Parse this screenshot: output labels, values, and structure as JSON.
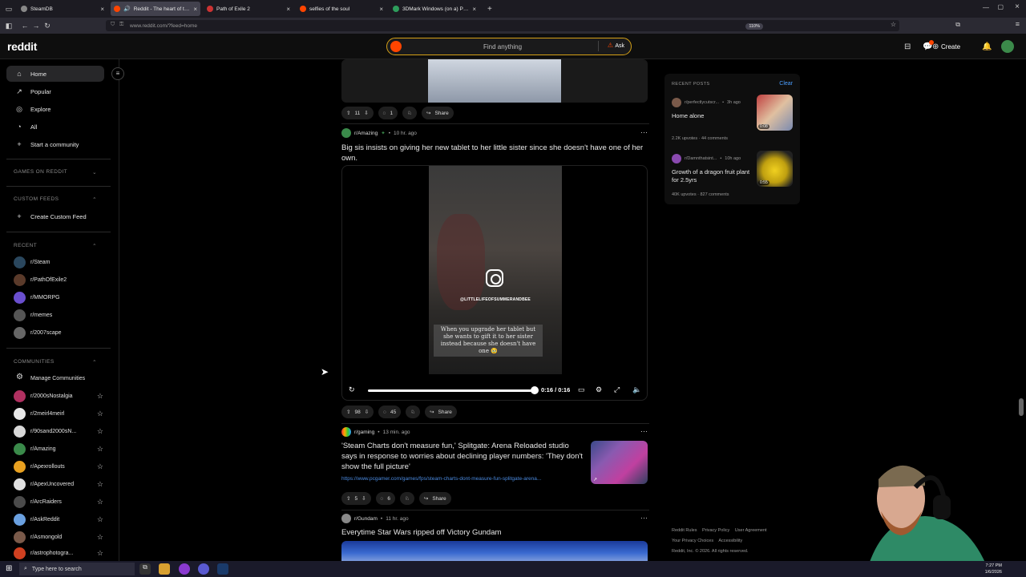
{
  "browser": {
    "tabs": [
      {
        "title": "SteamDB",
        "color": "#888888"
      },
      {
        "title": "Reddit - The heart of the internet",
        "color": "#ff4500"
      },
      {
        "title": "Path of Exile 2",
        "color": "#cc3333"
      },
      {
        "title": "selfies of the soul",
        "color": "#ff4500"
      },
      {
        "title": "3DMark Windows (on a) Phone",
        "color": "#2e9d5c"
      }
    ],
    "new_tab": "+",
    "url": "www.reddit.com/?feed=home",
    "zoom": "110%"
  },
  "header": {
    "logo": "reddit",
    "search_placeholder": "Find anything",
    "ask_label": "Ask",
    "create_label": "Create"
  },
  "sidebar": {
    "nav": [
      {
        "label": "Home",
        "icon": "home-icon"
      },
      {
        "label": "Popular",
        "icon": "popular-icon"
      },
      {
        "label": "Explore",
        "icon": "explore-icon"
      },
      {
        "label": "All",
        "icon": "all-icon"
      },
      {
        "label": "Start a community",
        "icon": "plus-icon"
      }
    ],
    "games_heading": "GAMES ON REDDIT",
    "custom_feeds_heading": "CUSTOM FEEDS",
    "create_custom_feed": "Create Custom Feed",
    "recent_heading": "RECENT",
    "recent": [
      {
        "name": "r/Steam",
        "color": "#2a475e"
      },
      {
        "name": "r/PathOfExile2",
        "color": "#5a3a2a"
      },
      {
        "name": "r/MMORPG",
        "color": "#6a4fcf"
      },
      {
        "name": "r/memes",
        "color": "#555555"
      },
      {
        "name": "r/2007scape",
        "color": "#666666"
      }
    ],
    "communities_heading": "COMMUNITIES",
    "manage_communities": "Manage Communities",
    "communities": [
      {
        "name": "r/2000sNostalgia",
        "color": "#b03060"
      },
      {
        "name": "r/2meirl4meirl",
        "color": "#e8e8e8"
      },
      {
        "name": "r/90sand2000sN...",
        "color": "#d8d8d8"
      },
      {
        "name": "r/Amazing",
        "color": "#3a8a4a"
      },
      {
        "name": "r/Apexrollouts",
        "color": "#e8a020"
      },
      {
        "name": "r/ApexUncovered",
        "color": "#e0e0e0"
      },
      {
        "name": "r/ArcRaiders",
        "color": "#4a4a4a"
      },
      {
        "name": "r/AskReddit",
        "color": "#6aa0e0"
      },
      {
        "name": "r/Asmongold",
        "color": "#7a5a4a"
      },
      {
        "name": "r/astrophotogra...",
        "color": "#d04020"
      }
    ]
  },
  "feed": {
    "post0_actions": {
      "votes": "11",
      "comments": "1",
      "share": "Share"
    },
    "post1": {
      "subreddit": "r/Amazing",
      "time": "10 hr. ago",
      "title": "Big sis insists on giving her new tablet to her little sister since she doesn't have one of her own.",
      "ig_handle": "@LITTLELIFEOFSUMMERANDBEE",
      "caption": "When you upgrade her tablet but she wants to gift it to her sister instead because she doesn't have one 🥹",
      "video_time": "0:16 / 0:16",
      "progress": 1.0,
      "votes": "98",
      "comments": "45",
      "share": "Share"
    },
    "post2": {
      "subreddit": "r/gaming",
      "time": "13 min. ago",
      "title": "'Steam Charts don't measure fun,' Splitgate: Arena Reloaded studio says in response to worries about declining player numbers: 'They don't show the full picture'",
      "link": "https://www.pcgamer.com/games/fps/steam-charts-dont-measure-fun-splitgate-arena...",
      "votes": "5",
      "comments": "6",
      "share": "Share"
    },
    "post3": {
      "subreddit": "r/Gundam",
      "time": "11 hr. ago",
      "title": "Everytime Star Wars ripped off Victory Gundam"
    }
  },
  "right": {
    "heading": "RECENT POSTS",
    "clear": "Clear",
    "posts": [
      {
        "sub": "r/perfectlycutscr...",
        "time": "3h ago",
        "title": "Home alone",
        "stats": "2.2K upvotes · 44 comments",
        "duration": "0:08"
      },
      {
        "sub": "r/Damnthatsint...",
        "time": "10h ago",
        "title": "Growth of a dragon fruit plant for 2.5yrs",
        "stats": "40K upvotes · 827 comments",
        "duration": "0:55"
      }
    ],
    "footer": {
      "links1": [
        "Reddit Rules",
        "Privacy Policy",
        "User Agreement"
      ],
      "links2": [
        "Your Privacy Choices",
        "Accessibility"
      ],
      "copyright": "Reddit, Inc. © 2026. All rights reserved."
    }
  },
  "taskbar": {
    "search_placeholder": "Type here to search",
    "time": "7:27 PM",
    "date": "1/6/2026"
  }
}
